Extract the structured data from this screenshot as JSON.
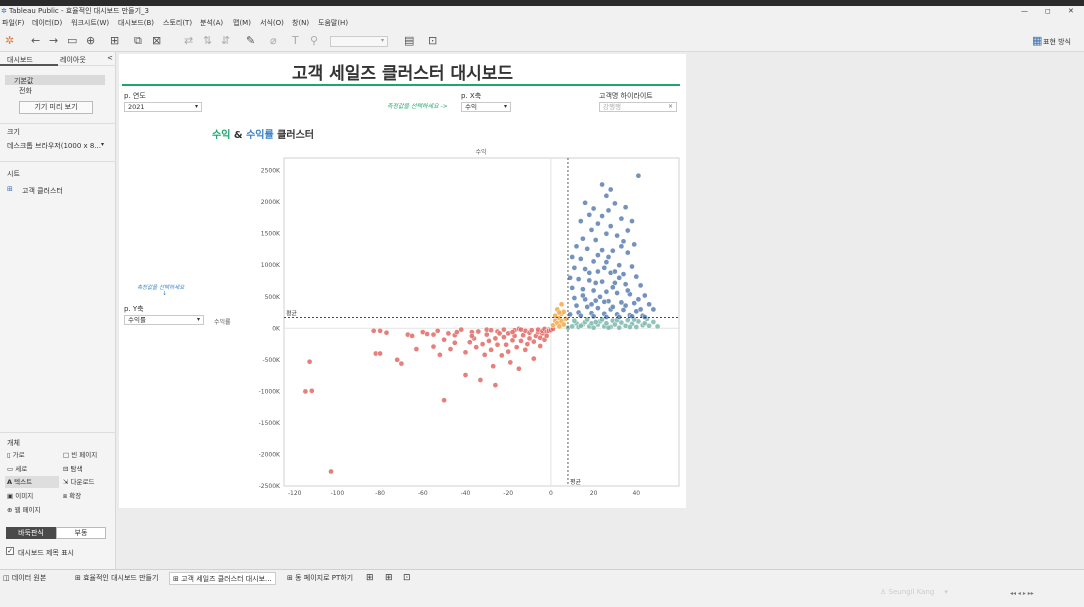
{
  "window": {
    "title": "Tableau Public - 효율적인 대시보드 만들기_3",
    "controls": [
      "—",
      "◻",
      "✕"
    ]
  },
  "menu": [
    "파일(F)",
    "데이터(D)",
    "워크시트(W)",
    "대시보드(B)",
    "스토리(T)",
    "분석(A)",
    "맵(M)",
    "서식(O)",
    "창(N)",
    "도움말(H)"
  ],
  "toolbar": {
    "presentation_label": "표현 방식"
  },
  "left_panel": {
    "tabs": [
      "대시보드",
      "레이아웃"
    ],
    "collapse": "<",
    "devices": [
      "기본값",
      "전화"
    ],
    "preview_button": "기기 미리 보기",
    "size_heading": "크기",
    "size_value": "데스크톱 브라우저(1000 x 8...",
    "sheets_heading": "시트",
    "sheet_item": "고객 클러스터",
    "objects_heading": "개체",
    "objects": [
      {
        "label": "가로",
        "icon": "horizontal-container-icon"
      },
      {
        "label": "빈 페이지",
        "icon": "blank-icon"
      },
      {
        "label": "세로",
        "icon": "vertical-container-icon"
      },
      {
        "label": "탐색",
        "icon": "navigation-icon"
      },
      {
        "label": "텍스트",
        "icon": "text-icon"
      },
      {
        "label": "다운로드",
        "icon": "download-icon"
      },
      {
        "label": "이미지",
        "icon": "image-icon"
      },
      {
        "label": "확장",
        "icon": "extension-icon"
      },
      {
        "label": "웹 페이지",
        "icon": "web-page-icon"
      }
    ],
    "layout_toggle": [
      "바둑판식",
      "부동"
    ],
    "show_title_label": "대시보드 제목 표시"
  },
  "dashboard": {
    "title": "고객 세일즈 클러스터 대시보드",
    "accent_color": "#1fa66b",
    "year_param": {
      "label": "p. 연도",
      "value": "2021"
    },
    "hint_x": "측정값을 선택하세요 ->",
    "x_param": {
      "label": "p. X축",
      "value": "수익"
    },
    "highlight": {
      "label": "고객명 하이라이트",
      "placeholder": "강행행"
    },
    "chart_title": {
      "part1": "수익",
      "amp": " & ",
      "part2": "수익률",
      "part3": " 클러스터"
    },
    "hint_y": "측정값을 선택하세요",
    "hint_y_arrow": "↓",
    "y_param": {
      "label": "p. Y축",
      "value": "수익률"
    },
    "y_axis_title": "수익률"
  },
  "chart_data": {
    "type": "scatter",
    "title": "수익 & 수익률 클러스터",
    "xlabel": "수익률",
    "ylabel": "수익",
    "xlim": [
      -125,
      60
    ],
    "ylim": [
      -2500,
      2700
    ],
    "x_ticks": [
      -120,
      -100,
      -80,
      -60,
      -40,
      -20,
      0,
      20,
      40
    ],
    "y_ticks": [
      -2500,
      -2000,
      -1500,
      -1000,
      -500,
      0,
      500,
      1000,
      1500,
      2000,
      2500
    ],
    "y_tick_labels": [
      "-2500K",
      "-2000K",
      "-1500K",
      "-1000K",
      "-500K",
      "0K",
      "500K",
      "1000K",
      "1500K",
      "2000K",
      "2500K"
    ],
    "ref_lines": {
      "x": 8,
      "y": 170,
      "label": "평균"
    },
    "colors": {
      "red": "#e26a66",
      "orange": "#f2a949",
      "teal": "#7cb8ae",
      "blue": "#5a80b3"
    },
    "series": [
      {
        "color_key": "red",
        "points": [
          [
            -103,
            -2270
          ],
          [
            -115,
            -1000
          ],
          [
            -112,
            -990
          ],
          [
            -113,
            -530
          ],
          [
            -83,
            -40
          ],
          [
            -80,
            -40
          ],
          [
            -77,
            -70
          ],
          [
            -82,
            -400
          ],
          [
            -80,
            -400
          ],
          [
            -72,
            -500
          ],
          [
            -70,
            -560
          ],
          [
            -67,
            -100
          ],
          [
            -65,
            -120
          ],
          [
            -63,
            -330
          ],
          [
            -60,
            -60
          ],
          [
            -58,
            -90
          ],
          [
            -55,
            -290
          ],
          [
            -53,
            -40
          ],
          [
            -52,
            -420
          ],
          [
            -50,
            -1140
          ],
          [
            -50,
            -180
          ],
          [
            -48,
            -80
          ],
          [
            -47,
            -330
          ],
          [
            -45,
            -110
          ],
          [
            -44,
            -60
          ],
          [
            -42,
            -20
          ],
          [
            -40,
            -380
          ],
          [
            -40,
            -740
          ],
          [
            -38,
            -220
          ],
          [
            -37,
            -60
          ],
          [
            -36,
            -160
          ],
          [
            -35,
            -300
          ],
          [
            -34,
            -50
          ],
          [
            -33,
            -820
          ],
          [
            -32,
            -250
          ],
          [
            -31,
            -420
          ],
          [
            -30,
            -100
          ],
          [
            -30,
            -20
          ],
          [
            -29,
            -200
          ],
          [
            -28,
            -340
          ],
          [
            -27,
            -600
          ],
          [
            -26,
            -160
          ],
          [
            -25,
            -50
          ],
          [
            -25,
            -260
          ],
          [
            -24,
            -80
          ],
          [
            -23,
            -430
          ],
          [
            -22,
            -140
          ],
          [
            -22,
            -20
          ],
          [
            -21,
            -260
          ],
          [
            -20,
            -80
          ],
          [
            -20,
            -370
          ],
          [
            -19,
            -540
          ],
          [
            -18,
            -190
          ],
          [
            -17,
            -120
          ],
          [
            -17,
            -30
          ],
          [
            -16,
            -300
          ],
          [
            -15,
            -640
          ],
          [
            -15,
            -10
          ],
          [
            -14,
            -200
          ],
          [
            -13,
            -110
          ],
          [
            -12,
            -40
          ],
          [
            -12,
            -340
          ],
          [
            -11,
            -250
          ],
          [
            -10,
            -160
          ],
          [
            -10,
            -70
          ],
          [
            -9,
            -30
          ],
          [
            -8,
            -480
          ],
          [
            -8,
            -210
          ],
          [
            -7,
            -120
          ],
          [
            -6,
            -60
          ],
          [
            -6,
            -20
          ],
          [
            -5,
            -280
          ],
          [
            -5,
            -150
          ],
          [
            -4,
            -80
          ],
          [
            -4,
            -40
          ],
          [
            -3,
            -10
          ],
          [
            -3,
            -180
          ],
          [
            -2,
            -60
          ],
          [
            -2,
            -120
          ],
          [
            -1,
            -20
          ],
          [
            -1,
            -40
          ],
          [
            0,
            -30
          ],
          [
            1,
            -10
          ],
          [
            -26,
            -900
          ],
          [
            -45,
            -230
          ],
          [
            -55,
            -100
          ],
          [
            -37,
            -120
          ],
          [
            -28,
            -30
          ],
          [
            -18,
            -60
          ],
          [
            -14,
            -20
          ]
        ]
      },
      {
        "color_key": "orange",
        "points": [
          [
            1,
            50
          ],
          [
            2,
            120
          ],
          [
            2,
            200
          ],
          [
            3,
            80
          ],
          [
            3,
            300
          ],
          [
            4,
            160
          ],
          [
            4,
            30
          ],
          [
            5,
            230
          ],
          [
            5,
            110
          ],
          [
            6,
            60
          ],
          [
            6,
            260
          ],
          [
            7,
            150
          ],
          [
            5,
            380
          ],
          [
            4,
            250
          ]
        ]
      },
      {
        "color_key": "teal",
        "points": [
          [
            8,
            10
          ],
          [
            10,
            30
          ],
          [
            12,
            80
          ],
          [
            13,
            20
          ],
          [
            15,
            60
          ],
          [
            16,
            100
          ],
          [
            18,
            30
          ],
          [
            19,
            80
          ],
          [
            20,
            10
          ],
          [
            22,
            60
          ],
          [
            23,
            110
          ],
          [
            25,
            30
          ],
          [
            26,
            80
          ],
          [
            28,
            20
          ],
          [
            29,
            120
          ],
          [
            30,
            60
          ],
          [
            32,
            10
          ],
          [
            33,
            90
          ],
          [
            35,
            40
          ],
          [
            36,
            130
          ],
          [
            38,
            70
          ],
          [
            40,
            20
          ],
          [
            41,
            110
          ],
          [
            43,
            50
          ],
          [
            44,
            80
          ],
          [
            46,
            40
          ],
          [
            48,
            100
          ],
          [
            50,
            30
          ],
          [
            11,
            120
          ],
          [
            17,
            140
          ],
          [
            24,
            140
          ],
          [
            31,
            130
          ],
          [
            39,
            140
          ],
          [
            45,
            150
          ],
          [
            14,
            40
          ],
          [
            27,
            10
          ],
          [
            37,
            20
          ],
          [
            21,
            100
          ]
        ]
      },
      {
        "color_key": "blue",
        "points": [
          [
            41,
            2420
          ],
          [
            24,
            2280
          ],
          [
            28,
            2200
          ],
          [
            26,
            2100
          ],
          [
            16,
            1990
          ],
          [
            30,
            1980
          ],
          [
            20,
            1900
          ],
          [
            27,
            1870
          ],
          [
            35,
            1920
          ],
          [
            18,
            1800
          ],
          [
            24,
            1780
          ],
          [
            33,
            1740
          ],
          [
            38,
            1700
          ],
          [
            14,
            1700
          ],
          [
            22,
            1660
          ],
          [
            28,
            1620
          ],
          [
            36,
            1550
          ],
          [
            19,
            1560
          ],
          [
            26,
            1500
          ],
          [
            31,
            1470
          ],
          [
            15,
            1420
          ],
          [
            21,
            1400
          ],
          [
            34,
            1380
          ],
          [
            39,
            1330
          ],
          [
            12,
            1300
          ],
          [
            17,
            1260
          ],
          [
            24,
            1240
          ],
          [
            29,
            1230
          ],
          [
            36,
            1200
          ],
          [
            10,
            1130
          ],
          [
            14,
            1100
          ],
          [
            20,
            1060
          ],
          [
            26,
            1050
          ],
          [
            32,
            1000
          ],
          [
            38,
            980
          ],
          [
            11,
            960
          ],
          [
            16,
            940
          ],
          [
            22,
            900
          ],
          [
            28,
            880
          ],
          [
            34,
            860
          ],
          [
            40,
            820
          ],
          [
            9,
            800
          ],
          [
            13,
            780
          ],
          [
            18,
            760
          ],
          [
            24,
            740
          ],
          [
            30,
            720
          ],
          [
            35,
            700
          ],
          [
            42,
            680
          ],
          [
            10,
            640
          ],
          [
            15,
            620
          ],
          [
            20,
            600
          ],
          [
            26,
            580
          ],
          [
            31,
            560
          ],
          [
            37,
            540
          ],
          [
            44,
            520
          ],
          [
            11,
            480
          ],
          [
            16,
            460
          ],
          [
            21,
            440
          ],
          [
            27,
            430
          ],
          [
            33,
            410
          ],
          [
            39,
            400
          ],
          [
            46,
            380
          ],
          [
            12,
            360
          ],
          [
            17,
            340
          ],
          [
            22,
            320
          ],
          [
            28,
            300
          ],
          [
            34,
            290
          ],
          [
            40,
            270
          ],
          [
            48,
            300
          ],
          [
            13,
            250
          ],
          [
            19,
            240
          ],
          [
            25,
            230
          ],
          [
            31,
            220
          ],
          [
            37,
            210
          ],
          [
            43,
            200
          ],
          [
            9,
            220
          ],
          [
            14,
            200
          ],
          [
            20,
            190
          ],
          [
            26,
            180
          ],
          [
            32,
            180
          ],
          [
            38,
            190
          ],
          [
            44,
            180
          ],
          [
            23,
            500
          ],
          [
            29,
            650
          ],
          [
            18,
            880
          ],
          [
            25,
            960
          ],
          [
            32,
            800
          ],
          [
            27,
            1130
          ],
          [
            33,
            1300
          ],
          [
            22,
            1160
          ],
          [
            30,
            900
          ],
          [
            21,
            720
          ],
          [
            36,
            600
          ],
          [
            41,
            460
          ],
          [
            15,
            520
          ],
          [
            25,
            420
          ],
          [
            35,
            360
          ],
          [
            42,
            300
          ],
          [
            29,
            340
          ],
          [
            19,
            380
          ]
        ]
      }
    ]
  },
  "status_tabs": [
    "데이터 원본",
    "효율적인 대시보드 만들기",
    "고객 세일즈 클러스터 대시보...",
    "동 페이지로 PT하기"
  ],
  "user": "Seungil Kang"
}
